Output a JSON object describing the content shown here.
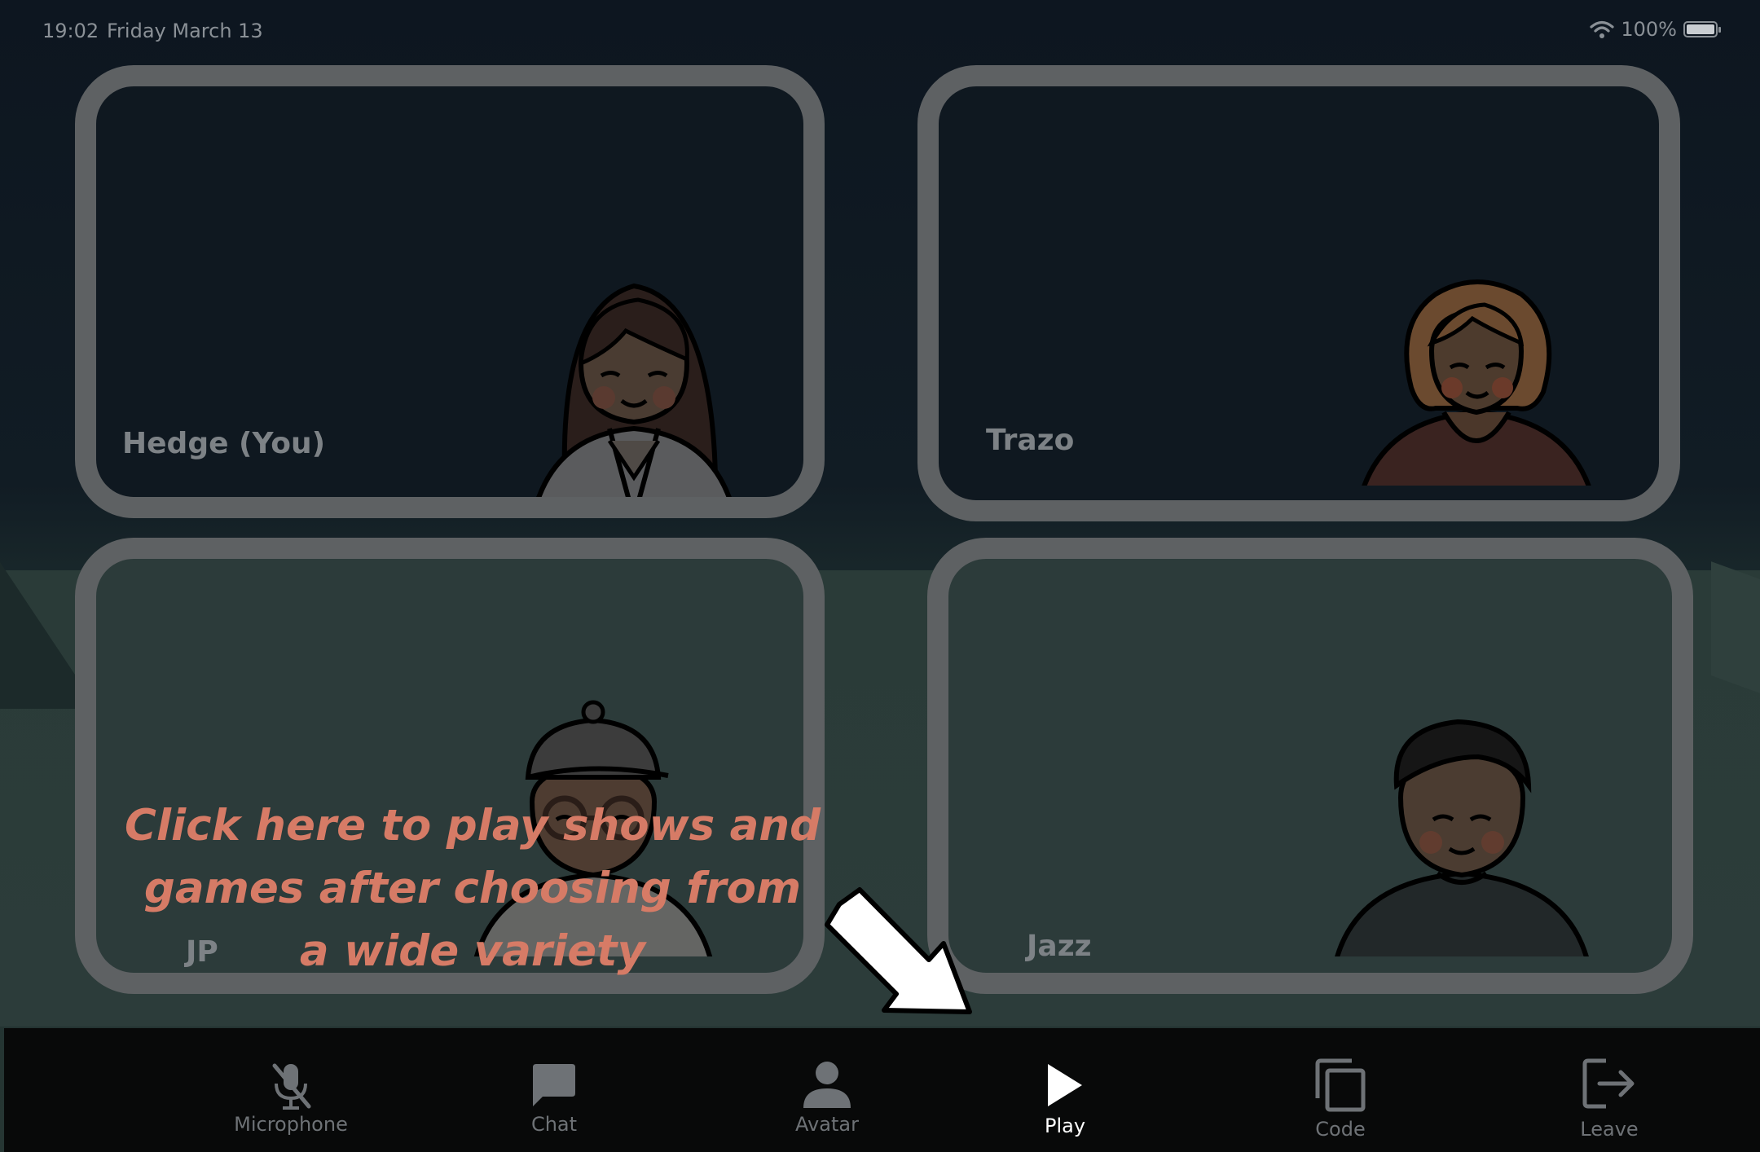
{
  "status_bar": {
    "time": "19:02",
    "date": "Friday March 13",
    "battery": "100%"
  },
  "tiles": [
    {
      "name": "Hedge (You)"
    },
    {
      "name": "Trazo"
    },
    {
      "name": "JP"
    },
    {
      "name": "Jazz"
    }
  ],
  "tutorial": {
    "text": "Click here to play shows and games after choosing from a wide variety"
  },
  "nav": {
    "microphone": "Microphone",
    "chat": "Chat",
    "avatar": "Avatar",
    "play": "Play",
    "code": "Code",
    "leave": "Leave"
  },
  "colors": {
    "tutorial_text": "#d67b66",
    "tile_border": "#5e6163",
    "active_nav": "#ffffff"
  }
}
